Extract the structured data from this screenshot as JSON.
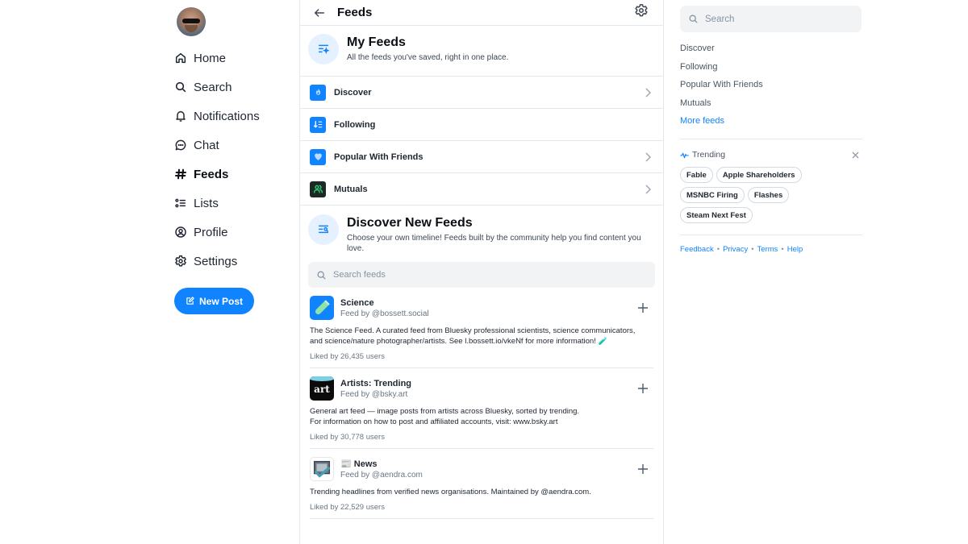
{
  "colors": {
    "accent": "#1083fe",
    "text_primary": "#0b0f14",
    "text_secondary": "#6a7684",
    "border": "#e4e8ee",
    "input_bg": "#f1f3f5"
  },
  "left_nav": {
    "avatar_alt": "User avatar",
    "items": [
      {
        "label": "Home",
        "icon": "home-icon",
        "active": false
      },
      {
        "label": "Search",
        "icon": "search-icon",
        "active": false
      },
      {
        "label": "Notifications",
        "icon": "bell-icon",
        "active": false
      },
      {
        "label": "Chat",
        "icon": "chat-icon",
        "active": false
      },
      {
        "label": "Feeds",
        "icon": "hashtag-icon",
        "active": true
      },
      {
        "label": "Lists",
        "icon": "list-icon",
        "active": false
      },
      {
        "label": "Profile",
        "icon": "profile-icon",
        "active": false
      },
      {
        "label": "Settings",
        "icon": "gear-icon",
        "active": false
      }
    ],
    "new_post_label": "New Post"
  },
  "header": {
    "title": "Feeds"
  },
  "my_feeds": {
    "title": "My Feeds",
    "subtitle": "All the feeds you've saved, right in one place.",
    "feeds": [
      {
        "name": "Discover",
        "icon": "discover-icon",
        "has_chevron": true
      },
      {
        "name": "Following",
        "icon": "following-icon",
        "has_chevron": false
      },
      {
        "name": "Popular With Friends",
        "icon": "heart-icon",
        "has_chevron": true
      },
      {
        "name": "Mutuals",
        "icon": "mutuals-icon",
        "has_chevron": true
      }
    ]
  },
  "discover_new": {
    "title": "Discover New Feeds",
    "subtitle": "Choose your own timeline! Feeds built by the community help you find content you love.",
    "search_placeholder": "Search feeds",
    "cards": [
      {
        "name": "Science",
        "by": "Feed by @bossett.social",
        "description": "The Science Feed. A curated feed from Bluesky professional scientists,  science communicators, and science/nature photographer/artists. See l.bossett.io/vkeNf for more information! 🧪",
        "liked": "Liked by 26,435 users"
      },
      {
        "name": "Artists: Trending",
        "by": "Feed by @bsky.art",
        "description": "General art feed — image posts from artists across Bluesky, sorted by trending.\nFor information on how to post and affiliated accounts, visit: www.bsky.art",
        "liked": "Liked by 30,778 users",
        "avatar_text": "art"
      },
      {
        "name": "📰 News",
        "by": "Feed by @aendra.com",
        "description": "Trending headlines from verified news organisations. Maintained by @aendra.com.",
        "liked": "Liked by 22,529 users"
      }
    ]
  },
  "right": {
    "search_placeholder": "Search",
    "links": [
      "Discover",
      "Following",
      "Popular With Friends",
      "Mutuals"
    ],
    "more_feeds": "More feeds",
    "trending_label": "Trending",
    "trending_topics": [
      "Fable",
      "Apple Shareholders",
      "MSNBC Firing",
      "Flashes",
      "Steam Next Fest"
    ],
    "footer": [
      "Feedback",
      "Privacy",
      "Terms",
      "Help"
    ],
    "footer_separator": "•"
  }
}
